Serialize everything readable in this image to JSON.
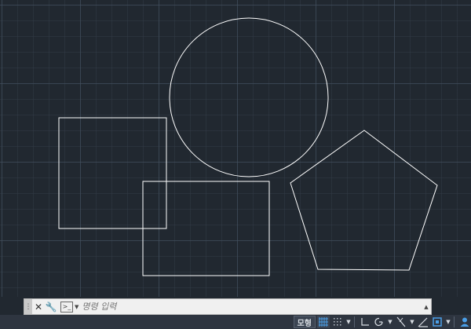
{
  "canvas": {
    "background": "#212830",
    "stroke_color": "#ffffff"
  },
  "command_line": {
    "placeholder": "명령 입력",
    "close_glyph": "✕",
    "customize_glyph": "🔧"
  },
  "status_bar": {
    "model_label": "모형",
    "accent_color": "#4a9fe8",
    "icons": [
      "grid-icon",
      "snap-icon",
      "ortho-icon",
      "polar-tracking-icon",
      "isodraft-icon",
      "object-snap-tracking-icon",
      "annotation-monitor-icon",
      "user-account-icon"
    ]
  }
}
